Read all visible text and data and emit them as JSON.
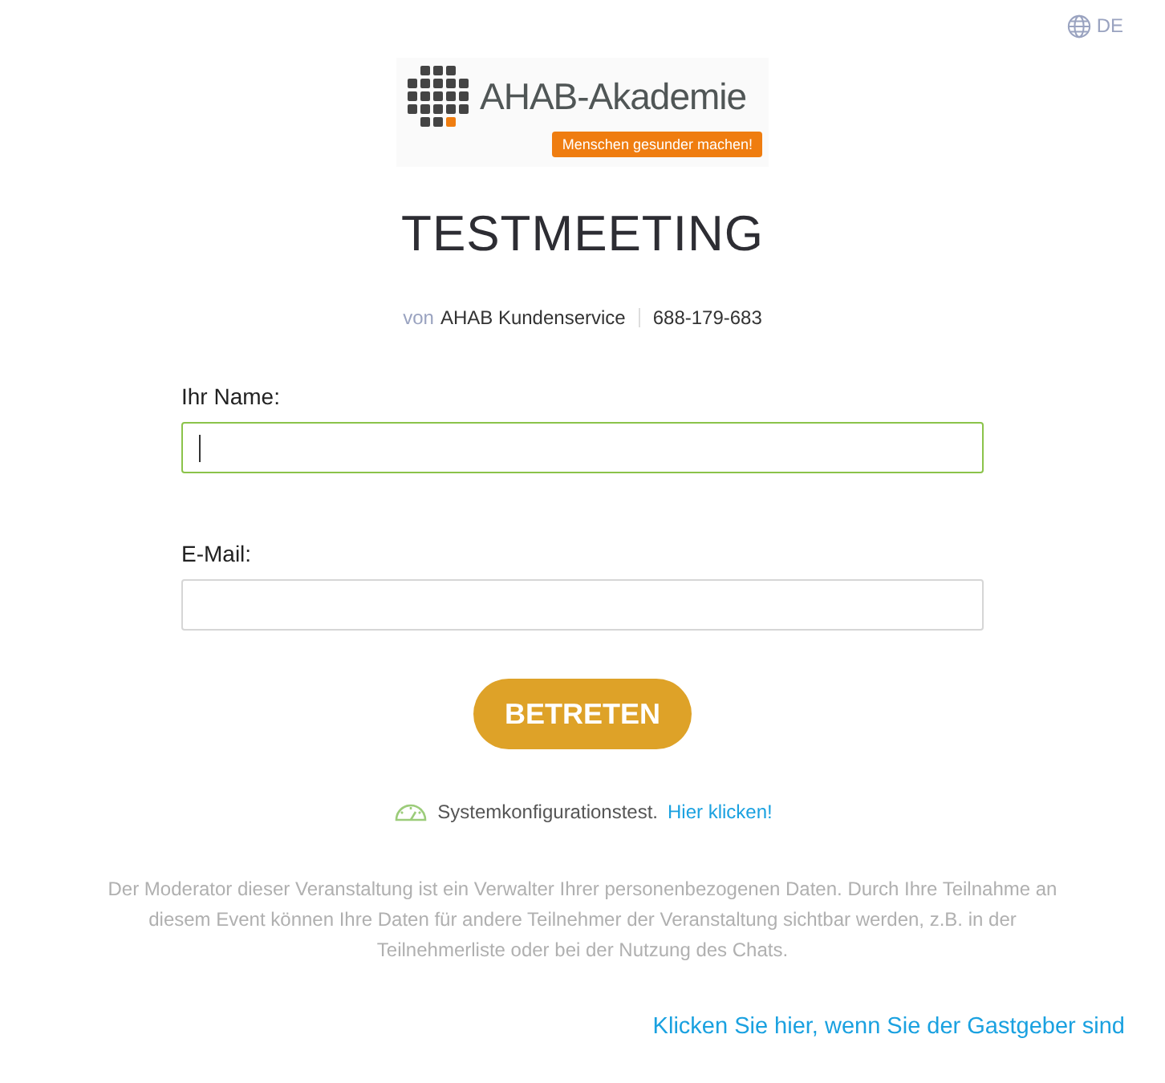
{
  "language": {
    "label": "DE"
  },
  "logo": {
    "name": "AHAB-Akademie",
    "tagline": "Menschen gesunder machen!"
  },
  "title": "TESTMEETING",
  "organizer": {
    "prefix": "von",
    "name": "AHAB Kundenservice",
    "meeting_id": "688-179-683"
  },
  "fields": [
    {
      "label": "Ihr Name:",
      "focused": true
    },
    {
      "label": "E-Mail:",
      "focused": false
    }
  ],
  "submit_button": "BETRETEN",
  "system_test": {
    "text": "Systemkonfigurationstest.",
    "link": "Hier klicken!"
  },
  "disclaimer": "Der Moderator dieser Veranstaltung ist ein Verwalter Ihrer personenbezogenen Daten. Durch Ihre Teilnahme an diesem Event können Ihre Daten für andere Teilnehmer der Veranstaltung sichtbar werden, z.B. in der Teilnehmerliste oder bei der Nutzung des Chats.",
  "host_link": "Klicken Sie hier, wenn Sie der Gastgeber sind"
}
